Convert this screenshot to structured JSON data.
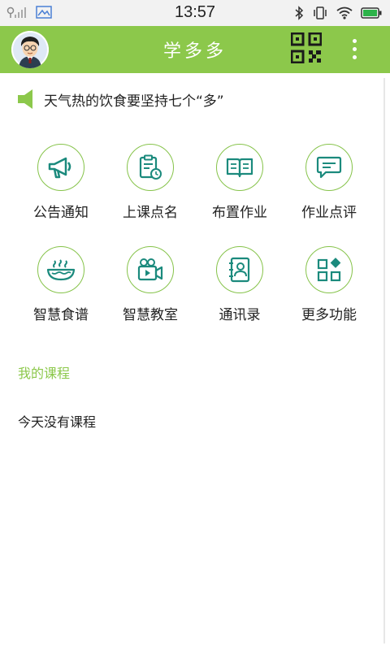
{
  "status_bar": {
    "time": "13:57",
    "icons": [
      "signal-icon",
      "image-icon",
      "bluetooth-icon",
      "vibrate-icon",
      "wifi-icon",
      "battery-icon"
    ]
  },
  "app_bar": {
    "title": "学多多",
    "icons": [
      "avatar",
      "qr-code-icon",
      "more-vert-icon"
    ]
  },
  "announcement": {
    "icon": "speaker-icon",
    "text": "天气热的饮食要坚持七个“多”"
  },
  "features": [
    {
      "label": "公告通知",
      "icon": "megaphone-icon"
    },
    {
      "label": "上课点名",
      "icon": "clipboard-clock-icon"
    },
    {
      "label": "布置作业",
      "icon": "open-book-icon"
    },
    {
      "label": "作业点评",
      "icon": "comment-icon"
    },
    {
      "label": "智慧食谱",
      "icon": "bowl-icon"
    },
    {
      "label": "智慧教室",
      "icon": "video-camera-icon"
    },
    {
      "label": "通讯录",
      "icon": "contacts-icon"
    },
    {
      "label": "更多功能",
      "icon": "apps-icon"
    }
  ],
  "courses": {
    "title": "我的课程",
    "empty_text": "今天没有课程"
  },
  "colors": {
    "accent": "#8cc84b",
    "icon": "#1b8a7d",
    "status_bar_bg": "#f2f2f2",
    "battery": "#2db34a"
  }
}
